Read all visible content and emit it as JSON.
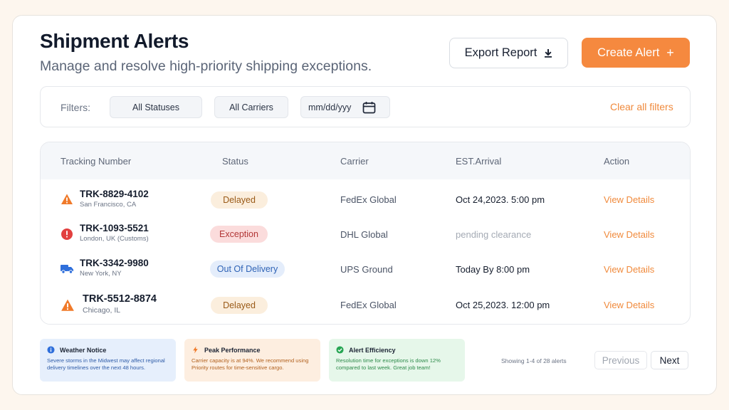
{
  "header": {
    "title": "Shipment Alerts",
    "subtitle": "Manage and resolve high-priority shipping exceptions.",
    "export_label": "Export Report",
    "create_label": "Create Alert",
    "create_icon": "+"
  },
  "filters": {
    "label": "Filters:",
    "status": "All Statuses",
    "carrier": "All Carriers",
    "date_placeholder": "mm/dd/yyy",
    "clear_label": "Clear all filters"
  },
  "table": {
    "columns": [
      "Tracking Number",
      "Status",
      "Carrier",
      "EST.Arrival",
      "Action"
    ],
    "rows": [
      {
        "icon": "warning-icon",
        "tracking": "TRK-8829-4102",
        "location": "San Francisco, CA",
        "status": "Delayed",
        "carrier": "FedEx Global",
        "arrival": "Oct 24,2023. 5:00 pm",
        "action": "View Details"
      },
      {
        "icon": "error-icon",
        "tracking": "TRK-1093-5521",
        "location": "London, UK (Customs)",
        "status": "Exception",
        "carrier": "DHL Global",
        "arrival": "pending clearance",
        "action": "View Details"
      },
      {
        "icon": "truck-icon",
        "tracking": "TRK-3342-9980",
        "location": "New York, NY",
        "status": "Out Of Delivery",
        "carrier": "UPS Ground",
        "arrival": "Today By 8:00 pm",
        "action": "View Details"
      },
      {
        "icon": "warning-icon",
        "tracking": "TRK-5512-8874",
        "location": "Chicago, IL",
        "status": "Delayed",
        "carrier": "FedEx Global",
        "arrival": "Oct 25,2023. 12:00 pm",
        "action": "View Details"
      }
    ]
  },
  "notices": {
    "weather": {
      "title": "Weather Notice",
      "body": "Severe storms in the Midwest may affect regional delivery timelines over the next 48 hours."
    },
    "peak": {
      "title": "Peak Performance",
      "body": "Carrier capacity is at 94%. We recommend using Priority routes for time-sensitive cargo."
    },
    "efficiency": {
      "title": "Alert Efficiency",
      "body": "Resolution time for exceptions is down 12% compared to last week. Great job team!"
    }
  },
  "pagination": {
    "summary": "Showing 1-4 of 28 alerts",
    "previous": "Previous",
    "next": "Next"
  },
  "colors": {
    "accent": "#f5893f",
    "warning": "#f07a2a",
    "error": "#e2403f",
    "info": "#2f6fdb",
    "success": "#27a653"
  }
}
